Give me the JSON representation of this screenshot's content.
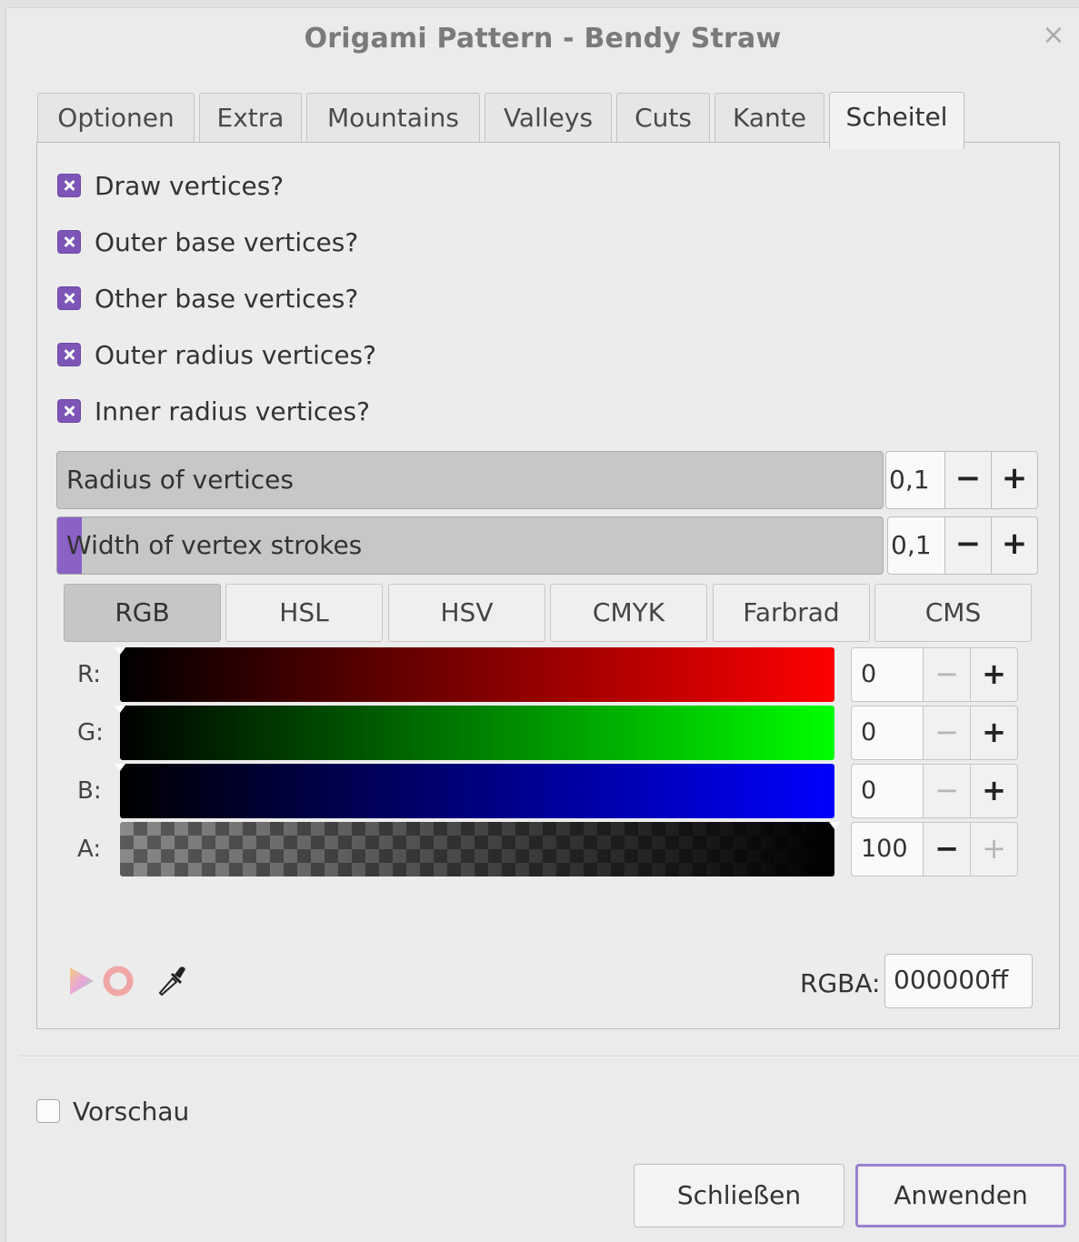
{
  "window": {
    "title": "Origami Pattern - Bendy Straw",
    "close_glyph": "×"
  },
  "tabs": [
    {
      "label": "Optionen",
      "active": false
    },
    {
      "label": "Extra",
      "active": false
    },
    {
      "label": "Mountains",
      "active": false
    },
    {
      "label": "Valleys",
      "active": false
    },
    {
      "label": "Cuts",
      "active": false
    },
    {
      "label": "Kante",
      "active": false
    },
    {
      "label": "Scheitel",
      "active": true
    }
  ],
  "checkboxes": [
    {
      "label": "Draw vertices?",
      "checked": true
    },
    {
      "label": "Outer base vertices?",
      "checked": true
    },
    {
      "label": "Other base vertices?",
      "checked": true
    },
    {
      "label": "Outer radius vertices?",
      "checked": true
    },
    {
      "label": "Inner radius vertices?",
      "checked": true
    }
  ],
  "sliders": [
    {
      "label": "Radius of vertices",
      "value": "0,1",
      "fill_fraction": 0.0,
      "minus": "−",
      "plus": "+"
    },
    {
      "label": "Width of vertex strokes",
      "value": "0,1",
      "fill_fraction": 0.03,
      "minus": "−",
      "plus": "+"
    }
  ],
  "color_modes": [
    {
      "label": "RGB",
      "active": true
    },
    {
      "label": "HSL",
      "active": false
    },
    {
      "label": "HSV",
      "active": false
    },
    {
      "label": "CMYK",
      "active": false
    },
    {
      "label": "Farbrad",
      "active": false
    },
    {
      "label": "CMS",
      "active": false
    }
  ],
  "channels": [
    {
      "label": "R:",
      "value": "0",
      "minus": "−",
      "plus": "+",
      "minus_enabled": false,
      "plus_enabled": true
    },
    {
      "label": "G:",
      "value": "0",
      "minus": "−",
      "plus": "+",
      "minus_enabled": false,
      "plus_enabled": true
    },
    {
      "label": "B:",
      "value": "0",
      "minus": "−",
      "plus": "+",
      "minus_enabled": false,
      "plus_enabled": true
    },
    {
      "label": "A:",
      "value": "100",
      "minus": "−",
      "plus": "+",
      "minus_enabled": true,
      "plus_enabled": false
    }
  ],
  "color_tools": {
    "icons": [
      "color-wheel-icon",
      "color-ring-icon",
      "eyedropper-icon"
    ],
    "rgba_label": "RGBA:",
    "rgba_value": "000000ff"
  },
  "footer": {
    "preview_label": "Vorschau",
    "preview_checked": false,
    "close_label": "Schließen",
    "apply_label": "Anwenden"
  },
  "colors": {
    "accent": "#7c55b7",
    "default_button_border": "#9a81cf"
  }
}
